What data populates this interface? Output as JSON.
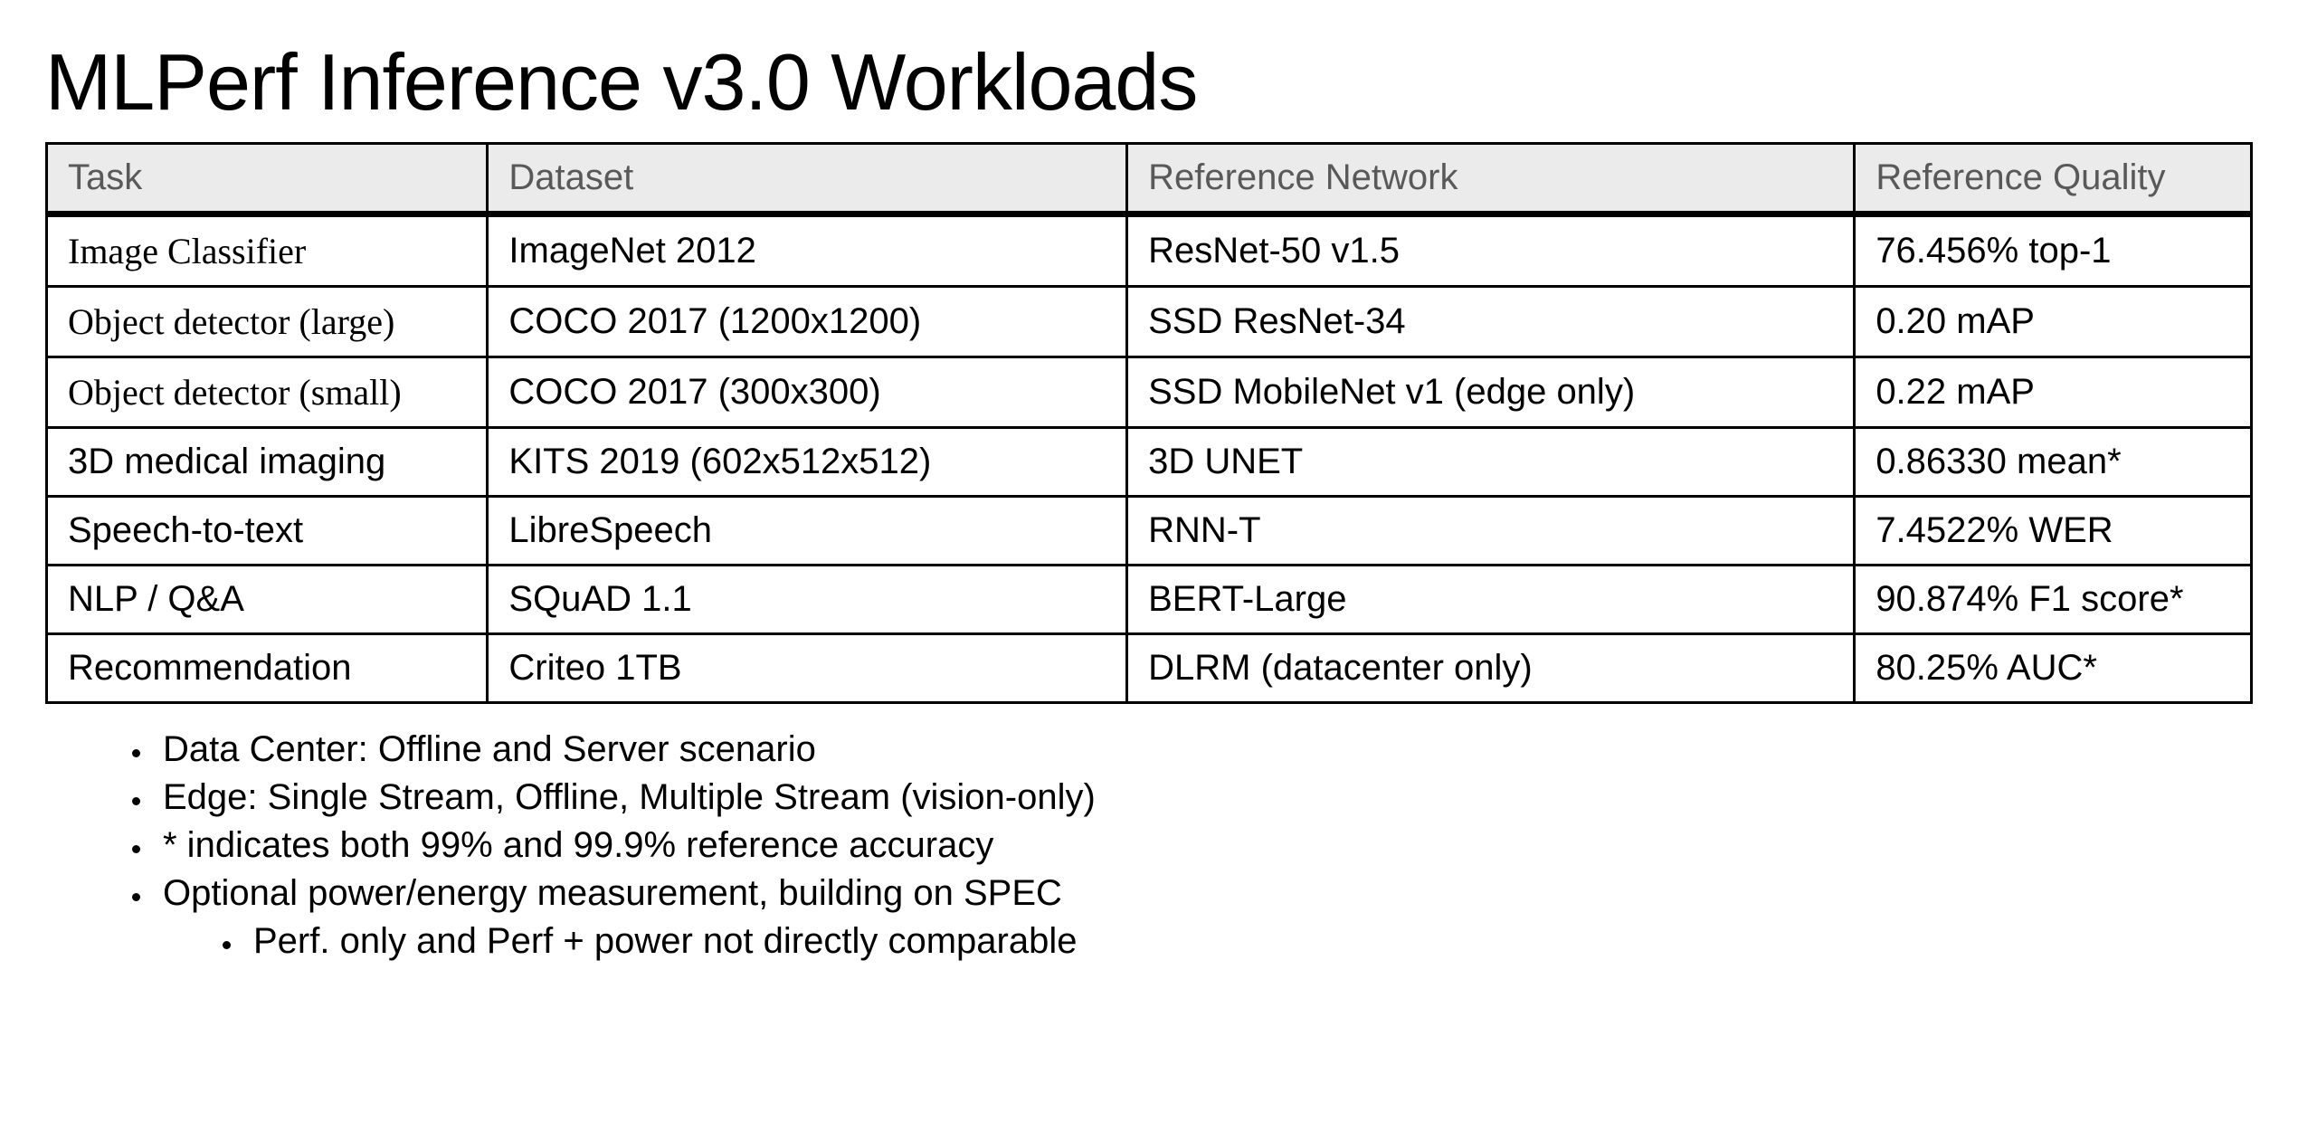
{
  "title": "MLPerf Inference v3.0 Workloads",
  "columns": {
    "task": "Task",
    "dataset": "Dataset",
    "network": "Reference Network",
    "quality": "Reference Quality"
  },
  "chart_data": {
    "type": "table",
    "title": "MLPerf Inference v3.0 Workloads",
    "columns": [
      "Task",
      "Dataset",
      "Reference Network",
      "Reference Quality"
    ],
    "rows": [
      {
        "task": "Image Classifier",
        "dataset": "ImageNet 2012",
        "network": "ResNet-50 v1.5",
        "quality": "76.456% top-1"
      },
      {
        "task": "Object detector (large)",
        "dataset": "COCO 2017 (1200x1200)",
        "network": "SSD ResNet-34",
        "quality": "0.20 mAP"
      },
      {
        "task": "Object detector (small)",
        "dataset": "COCO 2017  (300x300)",
        "network": "SSD MobileNet v1 (edge only)",
        "quality": "0.22 mAP"
      },
      {
        "task": "3D medical imaging",
        "dataset": "KITS 2019 (602x512x512)",
        "network": "3D UNET",
        "quality": "0.86330 mean*"
      },
      {
        "task": "Speech-to-text",
        "dataset": "LibreSpeech",
        "network": "RNN-T",
        "quality": "7.4522% WER"
      },
      {
        "task": "NLP / Q&A",
        "dataset": "SQuAD 1.1",
        "network": "BERT-Large",
        "quality": "90.874% F1 score*"
      },
      {
        "task": "Recommendation",
        "dataset": "Criteo 1TB",
        "network": "DLRM (datacenter only)",
        "quality": "80.25% AUC*"
      }
    ]
  },
  "notes": [
    "Data Center: Offline and Server scenario",
    "Edge: Single Stream, Offline, Multiple Stream (vision-only)",
    "* indicates both 99% and 99.9% reference accuracy",
    "Optional power/energy measurement, building on SPEC"
  ],
  "subnotes": [
    "Perf. only and Perf + power not directly comparable"
  ]
}
